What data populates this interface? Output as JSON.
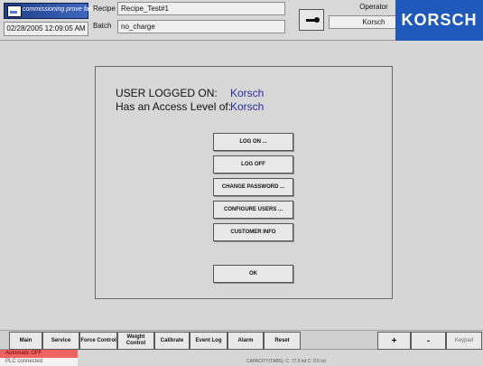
{
  "header": {
    "brand_label": "commissioning prove fable",
    "datetime": "02/28/2005 12:09:05 AM",
    "recipe_label": "Recipe",
    "recipe_value": "Recipe_Test#1",
    "batch_label": "Batch",
    "batch_value": "no_charge",
    "operator_label": "Operator",
    "operator_value": "Korsch",
    "logo": "KORSCH"
  },
  "main": {
    "user_logged_on_label": "USER LOGGED ON:",
    "user_logged_on_value": "Korsch",
    "access_level_label": "Has an Access Level of:",
    "access_level_value": "Korsch",
    "buttons": {
      "log_on": "LOG ON ...",
      "log_off": "LOG OFF",
      "change_password": "CHANGE PASSWORD ...",
      "configure_users": "CONFIGURE USERS ...",
      "customer_info": "CUSTOMER INFO",
      "ok": "OK"
    }
  },
  "bottom_nav": {
    "main": "Main",
    "service": "Service",
    "force_control": "Force Control",
    "weight_control": "Weight Control",
    "calibrate": "Calibrate",
    "event_log": "Event Log",
    "alarm": "Alarm",
    "reset": "Reset",
    "plus": "+",
    "minus": "-",
    "keypad": "Keypad"
  },
  "status": {
    "automatic": "Automatic OFF",
    "plc": "PLC connected",
    "capacity": "CAPACITY(TABS):       C:  77.5 kd       C:   9.5 kd"
  },
  "icons": {
    "brand_icon": "monitor-icon",
    "key_icon": "key-icon"
  },
  "colors": {
    "brand_blue": "#1f59bb",
    "status_red": "#f06363",
    "value_blue": "#2a2f9a"
  }
}
